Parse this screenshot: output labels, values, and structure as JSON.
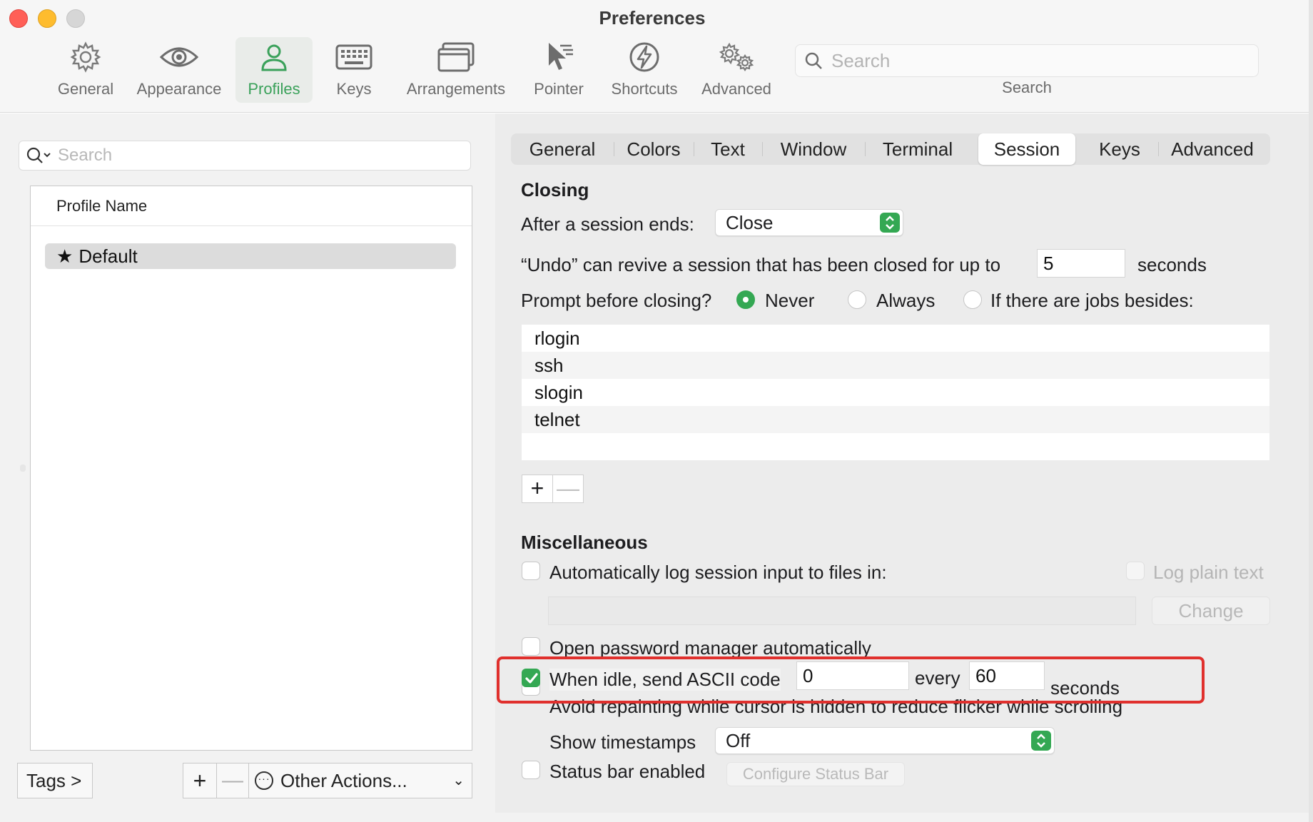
{
  "window": {
    "title": "Preferences"
  },
  "toolbar": {
    "items": [
      {
        "label": "General",
        "icon": "gear-icon"
      },
      {
        "label": "Appearance",
        "icon": "eye-icon"
      },
      {
        "label": "Profiles",
        "icon": "person-icon",
        "active": true
      },
      {
        "label": "Keys",
        "icon": "keyboard-icon"
      },
      {
        "label": "Arrangements",
        "icon": "windows-icon"
      },
      {
        "label": "Pointer",
        "icon": "pointer-icon"
      },
      {
        "label": "Shortcuts",
        "icon": "bolt-icon"
      },
      {
        "label": "Advanced",
        "icon": "gears-icon"
      }
    ],
    "search": {
      "placeholder": "Search",
      "caption": "Search"
    }
  },
  "profiles": {
    "search_placeholder": "Search",
    "column_header": "Profile Name",
    "items": [
      {
        "name": "Default",
        "default": true
      }
    ],
    "tags_label": "Tags >",
    "add_label": "+",
    "remove_label": "—",
    "other_actions_label": "Other Actions..."
  },
  "tabs": [
    {
      "label": "General"
    },
    {
      "label": "Colors"
    },
    {
      "label": "Text"
    },
    {
      "label": "Window"
    },
    {
      "label": "Terminal"
    },
    {
      "label": "Session",
      "selected": true
    },
    {
      "label": "Keys"
    },
    {
      "label": "Advanced"
    }
  ],
  "closing": {
    "title": "Closing",
    "after_session_label": "After a session ends:",
    "after_session_value": "Close",
    "undo_prefix": "“Undo” can revive a session that has been closed for up to",
    "undo_value": "5",
    "undo_suffix": "seconds",
    "prompt_label": "Prompt before closing?",
    "prompt_options": [
      "Never",
      "Always",
      "If there are jobs besides:"
    ],
    "prompt_selected": "Never",
    "jobs": [
      "rlogin",
      "ssh",
      "slogin",
      "telnet"
    ],
    "add_job_label": "+",
    "remove_job_label": "—"
  },
  "misc": {
    "title": "Miscellaneous",
    "auto_log_label": "Automatically log session input to files in:",
    "auto_log_checked": false,
    "log_plain_text_label": "Log plain text",
    "change_label": "Change",
    "password_manager_label": "Open password manager automatically",
    "password_manager_checked": false,
    "idle_label": "When idle, send ASCII code",
    "idle_checked": true,
    "idle_code": "0",
    "idle_every_label": "every",
    "idle_seconds": "60",
    "idle_seconds_label": "seconds",
    "avoid_repaint_label": "Avoid repainting while cursor is hidden to reduce flicker while scrolling",
    "avoid_repaint_checked": false,
    "timestamps_label": "Show timestamps",
    "timestamps_value": "Off",
    "status_bar_label": "Status bar enabled",
    "status_bar_checked": false,
    "configure_status_bar_label": "Configure Status Bar"
  },
  "colors": {
    "accent": "#34a853",
    "highlight": "#e0302d"
  }
}
